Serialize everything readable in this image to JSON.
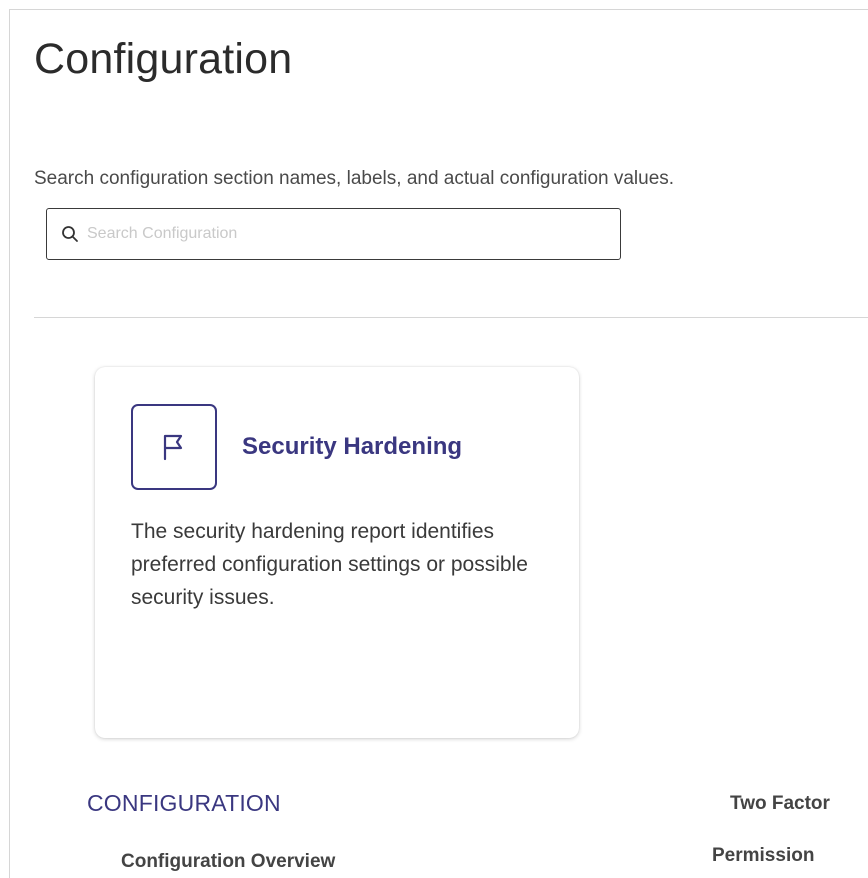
{
  "page": {
    "title": "Configuration"
  },
  "search": {
    "help_text": "Search configuration section names, labels, and actual configuration values.",
    "placeholder": "Search Configuration",
    "value": "",
    "icon": "search-icon"
  },
  "card": {
    "icon": "flag-icon",
    "title": "Security Hardening",
    "description": "The security hardening report identifies preferred configuration settings or possible security issues."
  },
  "sections": {
    "configuration_heading": "CONFIGURATION",
    "configuration_overview": "Configuration Overview",
    "two_factor": "Two Factor",
    "permission": "Permission"
  },
  "colors": {
    "accent": "#3a3780",
    "text": "#3a3a3a",
    "border": "#d6d6d6"
  }
}
